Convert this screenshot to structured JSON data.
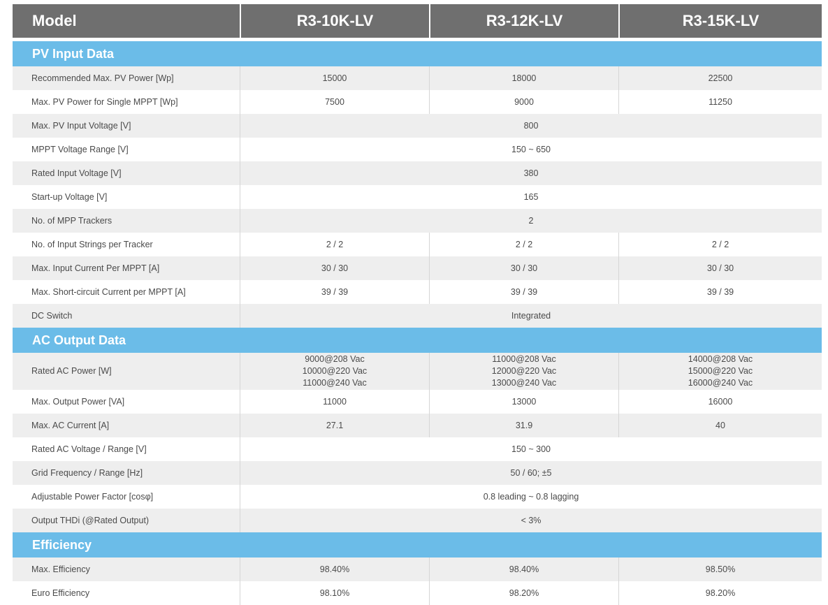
{
  "header": {
    "model_label": "Model",
    "models": [
      "R3-10K-LV",
      "R3-12K-LV",
      "R3-15K-LV"
    ]
  },
  "sections": {
    "pv": {
      "title": "PV Input Data",
      "rows": [
        {
          "label": "Recommended Max. PV Power [Wp]",
          "values": [
            "15000",
            "18000",
            "22500"
          ]
        },
        {
          "label": "Max. PV Power for Single MPPT [Wp]",
          "values": [
            "7500",
            "9000",
            "11250"
          ]
        },
        {
          "label": "Max. PV Input Voltage [V]",
          "value": "800"
        },
        {
          "label": "MPPT Voltage Range [V]",
          "value": "150 ~ 650"
        },
        {
          "label": "Rated Input Voltage [V]",
          "value": "380"
        },
        {
          "label": "Start-up Voltage [V]",
          "value": "165"
        },
        {
          "label": "No. of MPP Trackers",
          "value": "2"
        },
        {
          "label": "No. of Input Strings per Tracker",
          "values": [
            "2 / 2",
            "2 / 2",
            "2 / 2"
          ]
        },
        {
          "label": "Max. Input Current Per MPPT [A]",
          "values": [
            "30 / 30",
            "30 / 30",
            "30 / 30"
          ]
        },
        {
          "label": "Max. Short-circuit Current per MPPT [A]",
          "values": [
            "39 / 39",
            "39 / 39",
            "39 / 39"
          ]
        },
        {
          "label": "DC Switch",
          "value": "Integrated"
        }
      ]
    },
    "ac": {
      "title": "AC Output Data",
      "rated_ac_power": {
        "label": "Rated AC Power [W]",
        "values": [
          [
            "9000@208 Vac",
            "10000@220 Vac",
            "11000@240 Vac"
          ],
          [
            "11000@208 Vac",
            "12000@220 Vac",
            "13000@240 Vac"
          ],
          [
            "14000@208 Vac",
            "15000@220 Vac",
            "16000@240 Vac"
          ]
        ]
      },
      "rows": [
        {
          "label": "Max. Output Power [VA]",
          "values": [
            "11000",
            "13000",
            "16000"
          ]
        },
        {
          "label": "Max. AC Current [A]",
          "values": [
            "27.1",
            "31.9",
            "40"
          ]
        },
        {
          "label": "Rated AC Voltage / Range [V]",
          "value": "150 ~ 300"
        },
        {
          "label": "Grid Frequency / Range [Hz]",
          "value": "50 / 60; ±5"
        },
        {
          "label": "Adjustable Power Factor [cosφ]",
          "value": "0.8 leading ~ 0.8 lagging"
        },
        {
          "label": "Output THDi (@Rated Output)",
          "value": "< 3%"
        }
      ]
    },
    "eff": {
      "title": "Efficiency",
      "rows": [
        {
          "label": "Max. Efficiency",
          "values": [
            "98.40%",
            "98.40%",
            "98.50%"
          ]
        },
        {
          "label": "Euro Efficiency",
          "values": [
            "98.10%",
            "98.20%",
            "98.20%"
          ]
        }
      ]
    }
  },
  "colors": {
    "header_bg": "#6f6f6f",
    "section_bg": "#6bbce8",
    "row_alt_bg": "#eeeeee"
  }
}
